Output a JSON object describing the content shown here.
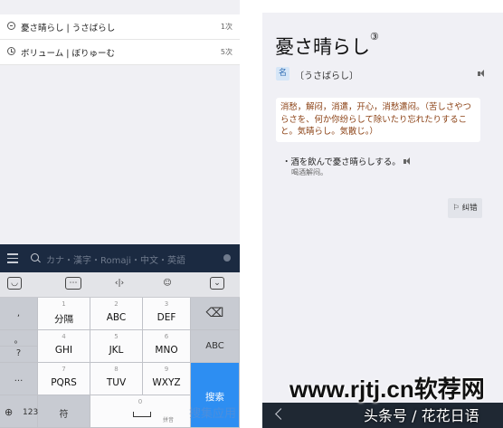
{
  "history": [
    {
      "icon": "minus-circle-icon",
      "text": "憂さ晴らし | うさばらし",
      "count": "1次"
    },
    {
      "icon": "clock-icon",
      "text": "ボリューム | ぼりゅーむ",
      "count": "5次"
    }
  ],
  "search": {
    "placeholder": "カナ・漢字・Romaji・中文・英語"
  },
  "keyboard": {
    "left_keys": [
      ",",
      "。",
      "?",
      "..."
    ],
    "rows": [
      [
        {
          "num": "1",
          "label": "分隔"
        },
        {
          "num": "2",
          "label": "ABC"
        },
        {
          "num": "3",
          "label": "DEF"
        }
      ],
      [
        {
          "num": "4",
          "label": "GHI"
        },
        {
          "num": "5",
          "label": "JKL"
        },
        {
          "num": "6",
          "label": "MNO"
        }
      ],
      [
        {
          "num": "7",
          "label": "PQRS"
        },
        {
          "num": "8",
          "label": "TUV"
        },
        {
          "num": "9",
          "label": "WXYZ"
        }
      ]
    ],
    "bottom": {
      "num_label": "123",
      "symbol_label": "符",
      "space_num": "0",
      "space_sub": "拼音"
    },
    "delete_label": "⌫",
    "abc_label": "ABC",
    "search_label": "搜索"
  },
  "entry": {
    "word": "憂さ晴らし",
    "sup": "③",
    "pos": "名",
    "reading": "〔うさばらし〕",
    "definition": "消愁，解闷，消遣，开心，消愁遣闷。（苦しさやつらさを、何か你纷らして除いたり忘れたりすること。気晴らし。気散じ。）",
    "example": "・酒を飲んで憂さ晴らしする。",
    "example_translation": "喝酒解闷。",
    "correct_label": "纠错"
  },
  "watermarks": {
    "site": "www.rjtj.cn软荐网",
    "author": "头条号 / 花花日语",
    "faint": "搜集应用"
  }
}
